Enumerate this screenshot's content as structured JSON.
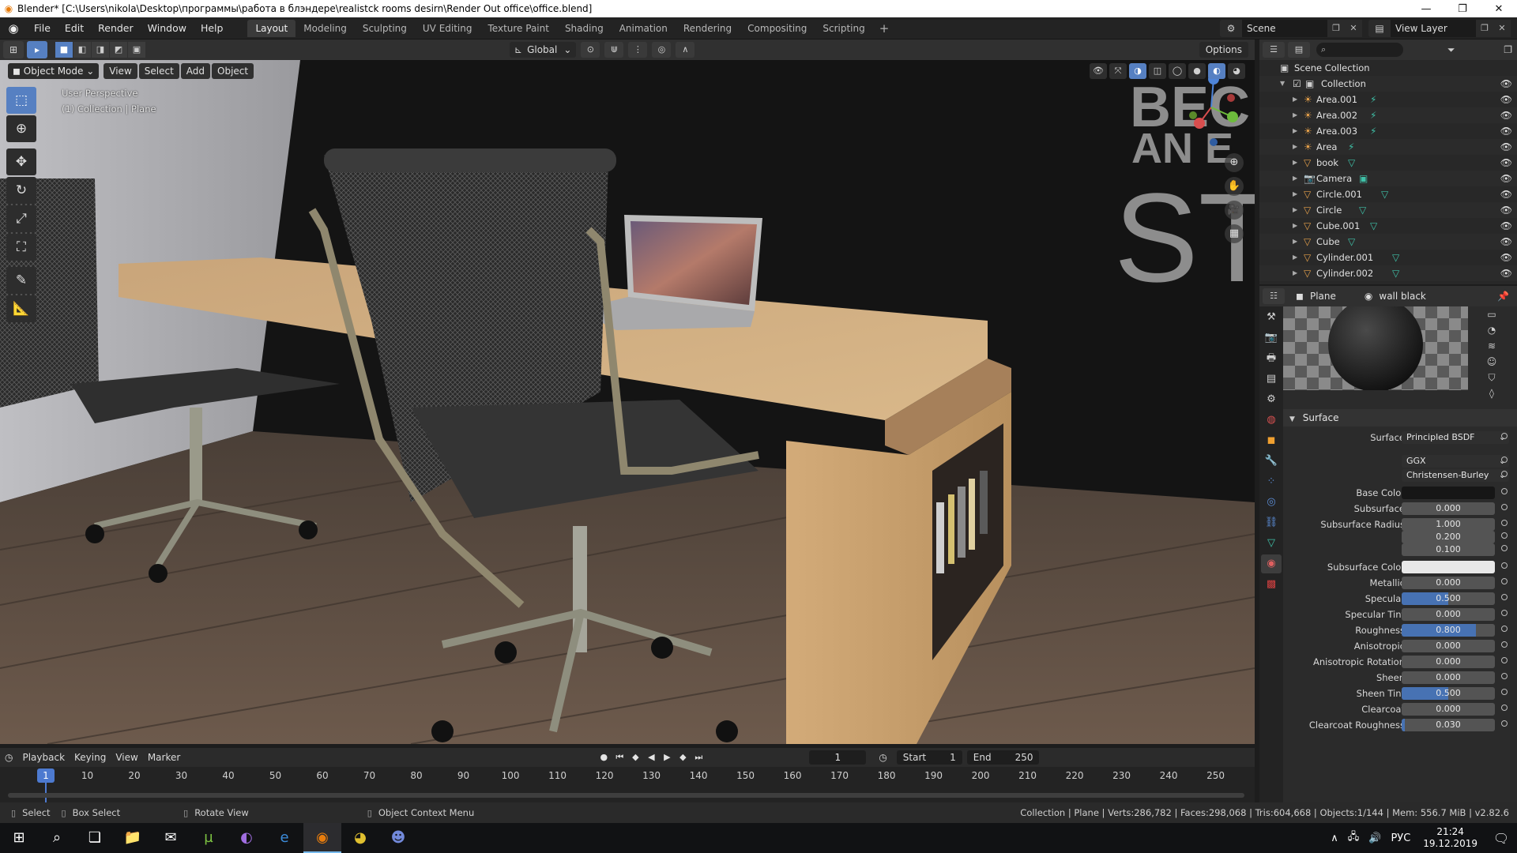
{
  "window": {
    "title": "Blender* [C:\\Users\\nikola\\Desktop\\программы\\работа в блэндере\\realistck rooms desirn\\Render Out office\\office.blend]",
    "minimize": "—",
    "maximize": "❐",
    "close": "✕"
  },
  "menu": {
    "items": [
      "File",
      "Edit",
      "Render",
      "Window",
      "Help"
    ],
    "workspaces": [
      "Layout",
      "Modeling",
      "Sculpting",
      "UV Editing",
      "Texture Paint",
      "Shading",
      "Animation",
      "Rendering",
      "Compositing",
      "Scripting"
    ],
    "scene": "Scene",
    "view_layer": "View Layer"
  },
  "viewport_header": {
    "orientation": "Global",
    "options": "Options"
  },
  "viewport": {
    "mode": "Object Mode",
    "menus": [
      "View",
      "Select",
      "Add",
      "Object"
    ],
    "info_line1": "User Perspective",
    "info_line2": "(1) Collection | Plane",
    "wall_text": [
      "BEC",
      "AN E",
      "ST"
    ]
  },
  "timeline": {
    "menus": [
      "Playback",
      "Keying",
      "View",
      "Marker"
    ],
    "current_frame": "1",
    "start_label": "Start",
    "start": "1",
    "end_label": "End",
    "end": "250",
    "ticks": [
      "1",
      "10",
      "20",
      "30",
      "40",
      "50",
      "60",
      "70",
      "80",
      "90",
      "100",
      "110",
      "120",
      "130",
      "140",
      "150",
      "160",
      "170",
      "180",
      "190",
      "200",
      "210",
      "220",
      "230",
      "240",
      "250"
    ]
  },
  "statusbar": {
    "select": "Select",
    "box_select": "Box Select",
    "rotate": "Rotate View",
    "context": "Object Context Menu",
    "stats": "Collection | Plane | Verts:286,782 | Faces:298,068 | Tris:604,668 | Objects:1/144 | Mem: 556.7 MiB | v2.82.6"
  },
  "outliner": {
    "root": "Scene Collection",
    "collection": "Collection",
    "items": [
      {
        "name": "Area.001",
        "type": "light"
      },
      {
        "name": "Area.002",
        "type": "light"
      },
      {
        "name": "Area.003",
        "type": "light"
      },
      {
        "name": "Area",
        "type": "light"
      },
      {
        "name": "book",
        "type": "mesh"
      },
      {
        "name": "Camera",
        "type": "camera"
      },
      {
        "name": "Circle.001",
        "type": "mesh"
      },
      {
        "name": "Circle",
        "type": "mesh"
      },
      {
        "name": "Cube.001",
        "type": "mesh"
      },
      {
        "name": "Cube",
        "type": "mesh"
      },
      {
        "name": "Cylinder.001",
        "type": "mesh"
      },
      {
        "name": "Cylinder.002",
        "type": "mesh"
      }
    ]
  },
  "properties": {
    "object": "Plane",
    "material": "wall black",
    "panel": "Surface",
    "rows": [
      {
        "label": "Surface",
        "value": "Principled BSDF",
        "kind": "dd"
      },
      {
        "label": "",
        "value": "GGX",
        "kind": "dd"
      },
      {
        "label": "",
        "value": "Christensen-Burley",
        "kind": "dd"
      },
      {
        "label": "Base Color",
        "value": "",
        "kind": "color",
        "color": "#161616"
      },
      {
        "label": "Subsurface",
        "value": "0.000",
        "kind": "num",
        "fill": 0
      },
      {
        "label": "Subsurface Radius",
        "value": "1.000",
        "kind": "num",
        "fill": 0
      },
      {
        "label": "",
        "value": "0.200",
        "kind": "num",
        "fill": 0
      },
      {
        "label": "",
        "value": "0.100",
        "kind": "num",
        "fill": 0
      },
      {
        "label": "Subsurface Color",
        "value": "",
        "kind": "color",
        "color": "#e8e8e8"
      },
      {
        "label": "Metallic",
        "value": "0.000",
        "kind": "num",
        "fill": 0
      },
      {
        "label": "Specular",
        "value": "0.500",
        "kind": "num",
        "fill": 0.5
      },
      {
        "label": "Specular Tint",
        "value": "0.000",
        "kind": "num",
        "fill": 0
      },
      {
        "label": "Roughness",
        "value": "0.800",
        "kind": "num",
        "fill": 0.8
      },
      {
        "label": "Anisotropic",
        "value": "0.000",
        "kind": "num",
        "fill": 0
      },
      {
        "label": "Anisotropic Rotation",
        "value": "0.000",
        "kind": "num",
        "fill": 0
      },
      {
        "label": "Sheen",
        "value": "0.000",
        "kind": "num",
        "fill": 0
      },
      {
        "label": "Sheen Tint",
        "value": "0.500",
        "kind": "num",
        "fill": 0.5
      },
      {
        "label": "Clearcoat",
        "value": "0.000",
        "kind": "num",
        "fill": 0
      },
      {
        "label": "Clearcoat Roughness",
        "value": "0.030",
        "kind": "num",
        "fill": 0.03
      }
    ]
  },
  "taskbar": {
    "lang": "РУС",
    "time": "21:24",
    "date": "19.12.2019"
  },
  "colors": {
    "accent": "#5680c2",
    "light_icon": "#e5a04a",
    "mesh_icon": "#3fc1a8",
    "camera_icon": "#7fa7d8"
  }
}
